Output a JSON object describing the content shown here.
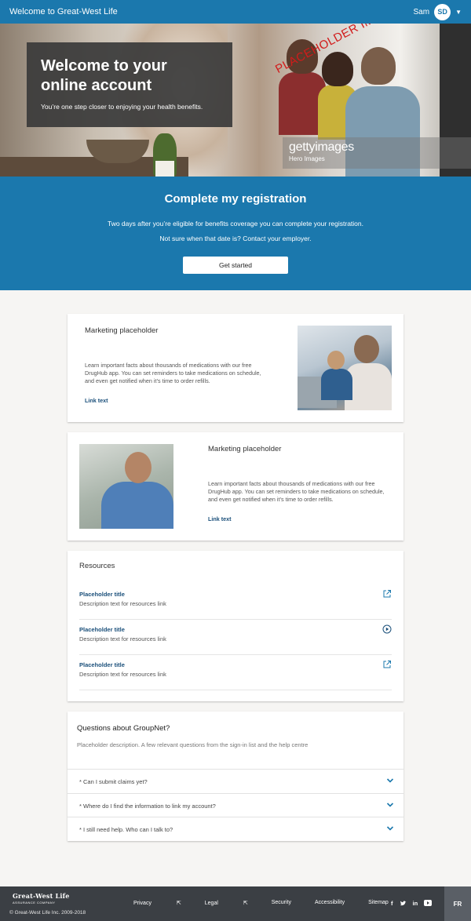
{
  "topbar": {
    "brand": "Welcome to Great-West Life",
    "user_name": "Sam",
    "avatar_initials": "SD"
  },
  "hero": {
    "title_line1": "Welcome to your",
    "title_line2": "online account",
    "subtitle": "You’re one step closer to enjoying your health benefits.",
    "watermark": "PLACEHOLDER IMAGE",
    "getty_logo": "gettyimages",
    "getty_credit": "Hero Images"
  },
  "registration": {
    "title": "Complete my registration",
    "line1": "Two days after you’re eligible for benefits coverage you can complete your registration.",
    "line2": "Not sure when that date is? Contact your employer.",
    "button": "Get started"
  },
  "marketing": [
    {
      "title": "Marketing placeholder",
      "body": "Learn important facts about thousands of medications with our free DrugHub app. You can set reminders to take medications on schedule, and even get notified when it’s time to order refills.",
      "link": "Link text"
    },
    {
      "title": "Marketing placeholder",
      "body": "Learn important facts about thousands of medications with our free DrugHub app. You can set reminders to take medications on schedule, and even get notified when it’s time to order refills.",
      "link": "Link text"
    }
  ],
  "resources": {
    "heading": "Resources",
    "items": [
      {
        "title": "Placeholder title",
        "description": "Description text for resources link",
        "icon": "external-link-icon"
      },
      {
        "title": "Placeholder title",
        "description": "Description text for resources link",
        "icon": "play-icon"
      },
      {
        "title": "Placeholder title",
        "description": "Description text for resources link",
        "icon": "external-link-icon"
      }
    ]
  },
  "faq": {
    "heading": "Questions about GroupNet?",
    "description": "Placeholder description. A few relevant questions from the sign-in list and the help centre",
    "items": [
      {
        "question": "* Can I submit claims yet?"
      },
      {
        "question": "* Where do I find the information to link my account?"
      },
      {
        "question": "* I still need help. Who can I talk to?"
      }
    ]
  },
  "footer": {
    "logo_line1": "Great-West Life",
    "logo_line2": "ASSURANCE COMPANY",
    "copyright": "© Great-West Life Inc. 2009-2018",
    "links": [
      "Privacy",
      "Legal",
      "Security",
      "Accessibility",
      "Sitemap"
    ],
    "social": [
      "f",
      "twitter",
      "in",
      "youtube"
    ],
    "language": "FR"
  },
  "colors": {
    "primary_blue": "#1b78ad",
    "link_blue": "#1a4f7a",
    "footer_bg": "#3b3f44",
    "watermark_red": "#d21b1b"
  }
}
